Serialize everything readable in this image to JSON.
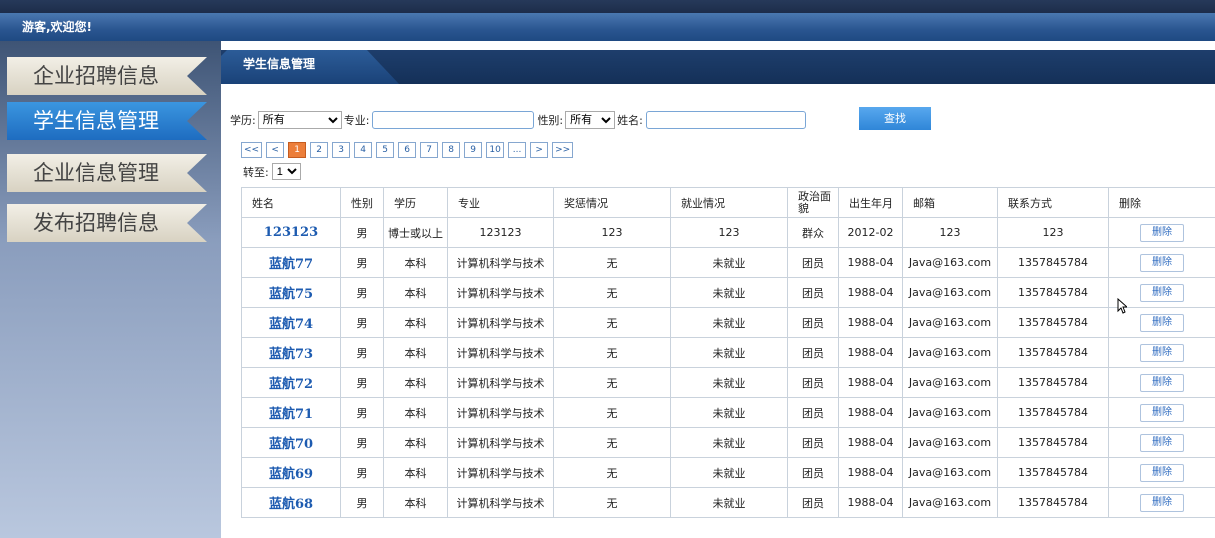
{
  "welcome": "游客,欢迎您!",
  "sidebar": {
    "items": [
      {
        "label": "企业招聘信息",
        "active": false
      },
      {
        "label": "学生信息管理",
        "active": true
      },
      {
        "label": "企业信息管理",
        "active": false
      },
      {
        "label": "发布招聘信息",
        "active": false
      }
    ]
  },
  "tab": {
    "label": "学生信息管理"
  },
  "filter": {
    "education_label": "学历:",
    "education_value": "所有",
    "major_label": "专业:",
    "major_value": "",
    "gender_label": "性别:",
    "gender_value": "所有",
    "name_label": "姓名:",
    "name_value": "",
    "search_button": "查找"
  },
  "pager": {
    "items": [
      "<<",
      "<",
      "1",
      "2",
      "3",
      "4",
      "5",
      "6",
      "7",
      "8",
      "9",
      "10",
      "...",
      ">",
      ">>"
    ],
    "current": "1",
    "goto_label": "转至:",
    "goto_value": "1"
  },
  "table": {
    "headers": [
      "姓名",
      "性别",
      "学历",
      "专业",
      "奖惩情况",
      "就业情况",
      "政治面貌",
      "出生年月",
      "邮箱",
      "联系方式",
      "删除"
    ],
    "delete_label": "删除",
    "rows": [
      [
        "123123",
        "男",
        "博士或以上",
        "123123",
        "123",
        "123",
        "群众",
        "2012-02",
        "123",
        "123"
      ],
      [
        "蓝航77",
        "男",
        "本科",
        "计算机科学与技术",
        "无",
        "未就业",
        "团员",
        "1988-04",
        "Java@163.com",
        "1357845784"
      ],
      [
        "蓝航75",
        "男",
        "本科",
        "计算机科学与技术",
        "无",
        "未就业",
        "团员",
        "1988-04",
        "Java@163.com",
        "1357845784"
      ],
      [
        "蓝航74",
        "男",
        "本科",
        "计算机科学与技术",
        "无",
        "未就业",
        "团员",
        "1988-04",
        "Java@163.com",
        "1357845784"
      ],
      [
        "蓝航73",
        "男",
        "本科",
        "计算机科学与技术",
        "无",
        "未就业",
        "团员",
        "1988-04",
        "Java@163.com",
        "1357845784"
      ],
      [
        "蓝航72",
        "男",
        "本科",
        "计算机科学与技术",
        "无",
        "未就业",
        "团员",
        "1988-04",
        "Java@163.com",
        "1357845784"
      ],
      [
        "蓝航71",
        "男",
        "本科",
        "计算机科学与技术",
        "无",
        "未就业",
        "团员",
        "1988-04",
        "Java@163.com",
        "1357845784"
      ],
      [
        "蓝航70",
        "男",
        "本科",
        "计算机科学与技术",
        "无",
        "未就业",
        "团员",
        "1988-04",
        "Java@163.com",
        "1357845784"
      ],
      [
        "蓝航69",
        "男",
        "本科",
        "计算机科学与技术",
        "无",
        "未就业",
        "团员",
        "1988-04",
        "Java@163.com",
        "1357845784"
      ],
      [
        "蓝航68",
        "男",
        "本科",
        "计算机科学与技术",
        "无",
        "未就业",
        "团员",
        "1988-04",
        "Java@163.com",
        "1357845784"
      ]
    ]
  },
  "colors": {
    "accent": "#1e6cc0",
    "current_page": "#ec7e3a",
    "name_link": "#1d5bb0"
  }
}
